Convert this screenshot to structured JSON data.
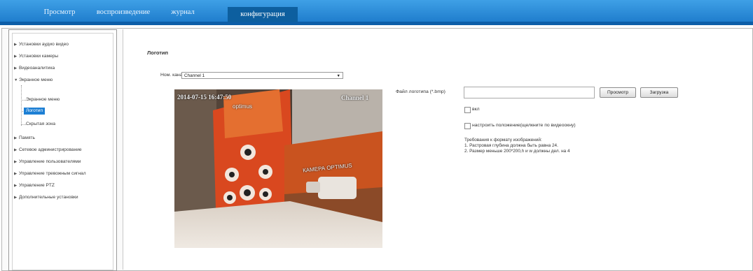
{
  "tabs": [
    {
      "label": "Просмотр"
    },
    {
      "label": "воспроизведение"
    },
    {
      "label": "журнал"
    },
    {
      "label": "конфигурация",
      "active": true
    }
  ],
  "sidebar": {
    "items": [
      {
        "label": "Установки аудио видео",
        "expanded": false
      },
      {
        "label": "Установки камеры",
        "expanded": false
      },
      {
        "label": "Видеоаналитика",
        "expanded": false
      },
      {
        "label": "Экранное меню",
        "expanded": true
      },
      {
        "label": "Память",
        "expanded": false
      },
      {
        "label": "Сетевое администрирование",
        "expanded": false
      },
      {
        "label": "Управление пользователями",
        "expanded": false
      },
      {
        "label": "Управление тревожным сигнал",
        "expanded": false
      },
      {
        "label": "Управление PTZ",
        "expanded": false
      },
      {
        "label": "Дополнительные установки",
        "expanded": false
      }
    ],
    "subitems": [
      {
        "label": "Экранное меню"
      },
      {
        "label": "Логотип",
        "selected": true
      },
      {
        "label": "Скрытая зона"
      }
    ]
  },
  "main": {
    "title": "Логотип",
    "channel_label": "Ном. канала",
    "channel_value": "Channel 1",
    "file_label": "Файл логотипа (*.bmp)",
    "file_value": "",
    "browse_label": "Просмотр",
    "upload_label": "Загрузка",
    "enable_label": "вкл",
    "position_label": "настроить положение(щелкните по видеоокну)",
    "requirements": {
      "heading": "Требования к формату изображений:",
      "line1": "1. Растровая глубина должна быть равна 24.",
      "line2": "2. Размер меньше 200*200,h и w должны  дел. на 4"
    }
  },
  "video": {
    "timestamp": "2014-07-15 16:47:50",
    "channel_osd": "Channel 1",
    "poster_brand": "optimus",
    "box_text": "КАМЕРА OPTIMUS"
  },
  "colors": {
    "topbar": "#1a78c9",
    "active_tab": "#0d5f9f",
    "selected_item": "#1d7fd4"
  }
}
